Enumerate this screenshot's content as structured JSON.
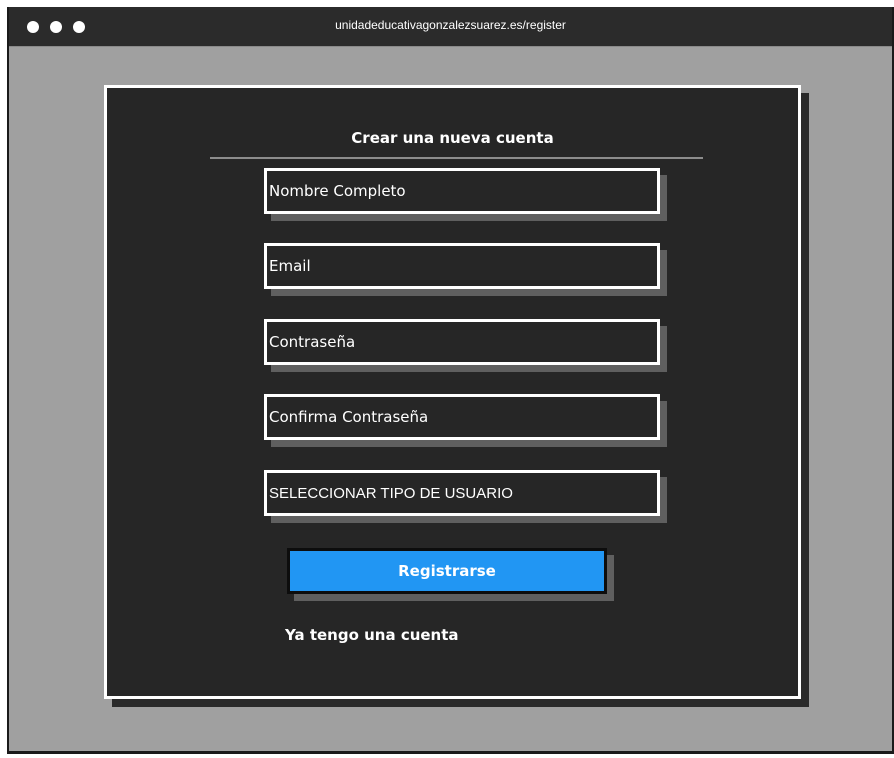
{
  "browser": {
    "url": "unidadeducativagonzalezsuarez.es/register"
  },
  "form": {
    "title": "Crear una nueva cuenta",
    "full_name_placeholder": "Nombre Completo",
    "email_placeholder": "Email",
    "password_placeholder": "Contraseña",
    "confirm_password_placeholder": "Confirma Contraseña",
    "user_type_placeholder": "SELECCIONAR TIPO DE USUARIO",
    "submit_label": "Registrarse",
    "login_link": "Ya tengo una cuenta"
  },
  "colors": {
    "window_bg": "#a0a0a0",
    "card_bg": "#262626",
    "accent": "#2196f3",
    "titlebar": "#2b2b2b"
  }
}
